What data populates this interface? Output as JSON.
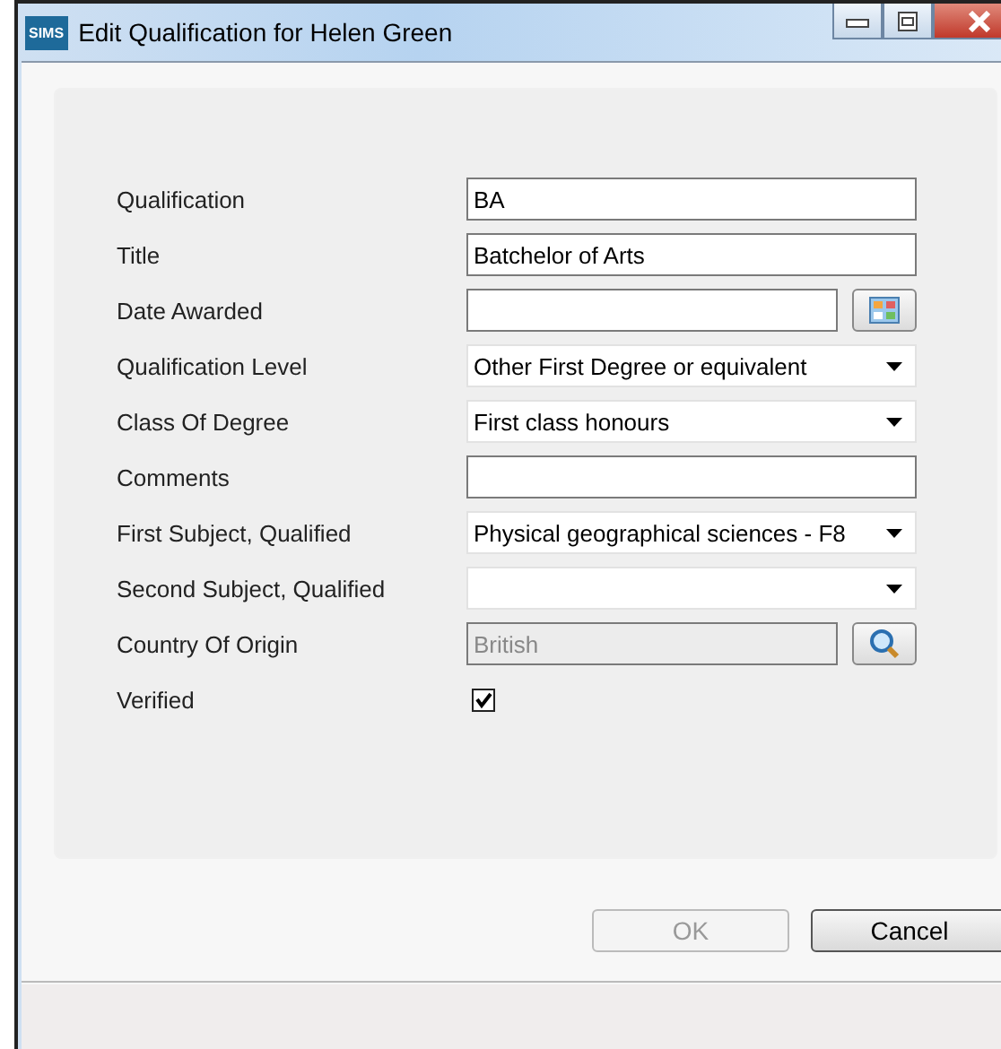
{
  "window": {
    "logo": "SIMS",
    "title": "Edit Qualification for Helen Green"
  },
  "fields": [
    {
      "kind": "text",
      "label": "Qualification",
      "value": "BA"
    },
    {
      "kind": "text",
      "label": "Title",
      "value": "Batchelor of Arts"
    },
    {
      "kind": "date",
      "label": "Date Awarded"
    },
    {
      "kind": "dropdown",
      "label": "Qualification Level",
      "value": "Other First Degree or equivalent"
    },
    {
      "kind": "dropdown",
      "label": "Class Of Degree",
      "value": "First class honours"
    },
    {
      "kind": "text",
      "label": "Comments"
    },
    {
      "kind": "dropdown",
      "label": "First Subject, Qualified",
      "value": "Physical geographical sciences - F8"
    },
    {
      "kind": "dropdown",
      "label": "Second Subject, Qualified"
    },
    {
      "kind": "lookup",
      "label": "Country Of Origin",
      "value": "British",
      "disabled": true
    },
    {
      "kind": "checkbox",
      "label": "Verified",
      "checked": true
    }
  ],
  "buttons": [
    {
      "label": "OK",
      "disabled": true
    },
    {
      "label": "Cancel",
      "disabled": false
    }
  ]
}
